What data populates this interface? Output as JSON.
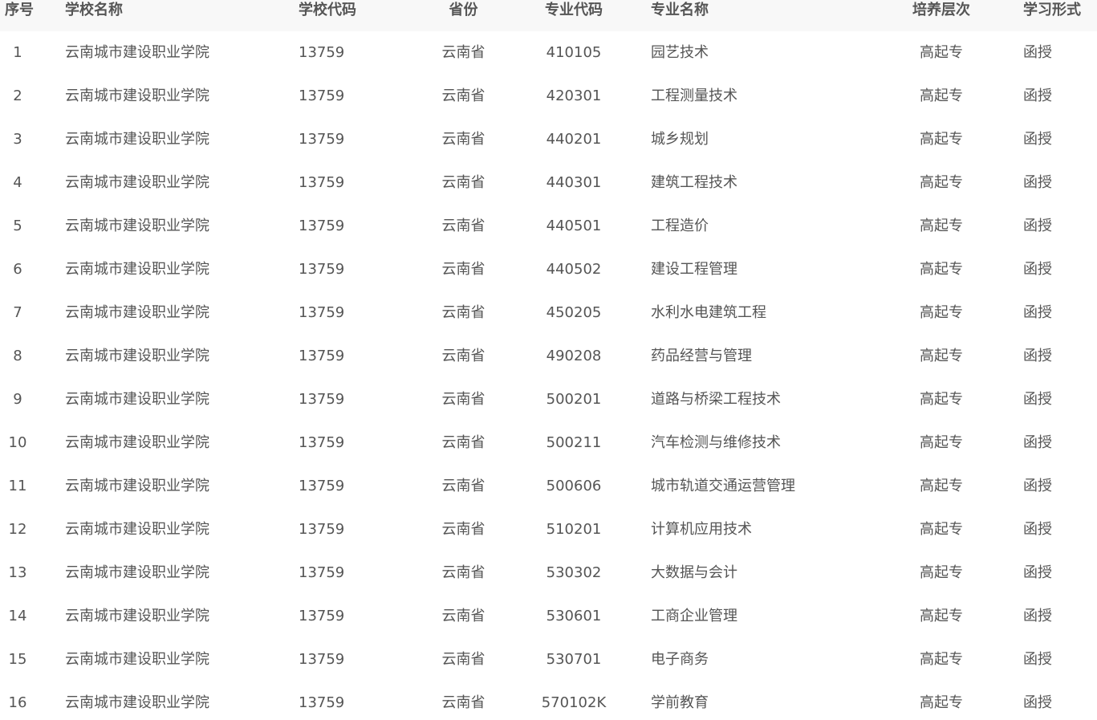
{
  "table": {
    "headers": [
      "序号",
      "学校名称",
      "学校代码",
      "省份",
      "专业代码",
      "专业名称",
      "培养层次",
      "学习形式"
    ],
    "rows": [
      [
        "1",
        "云南城市建设职业学院",
        "13759",
        "云南省",
        "410105",
        "园艺技术",
        "高起专",
        "函授"
      ],
      [
        "2",
        "云南城市建设职业学院",
        "13759",
        "云南省",
        "420301",
        "工程测量技术",
        "高起专",
        "函授"
      ],
      [
        "3",
        "云南城市建设职业学院",
        "13759",
        "云南省",
        "440201",
        "城乡规划",
        "高起专",
        "函授"
      ],
      [
        "4",
        "云南城市建设职业学院",
        "13759",
        "云南省",
        "440301",
        "建筑工程技术",
        "高起专",
        "函授"
      ],
      [
        "5",
        "云南城市建设职业学院",
        "13759",
        "云南省",
        "440501",
        "工程造价",
        "高起专",
        "函授"
      ],
      [
        "6",
        "云南城市建设职业学院",
        "13759",
        "云南省",
        "440502",
        "建设工程管理",
        "高起专",
        "函授"
      ],
      [
        "7",
        "云南城市建设职业学院",
        "13759",
        "云南省",
        "450205",
        "水利水电建筑工程",
        "高起专",
        "函授"
      ],
      [
        "8",
        "云南城市建设职业学院",
        "13759",
        "云南省",
        "490208",
        "药品经营与管理",
        "高起专",
        "函授"
      ],
      [
        "9",
        "云南城市建设职业学院",
        "13759",
        "云南省",
        "500201",
        "道路与桥梁工程技术",
        "高起专",
        "函授"
      ],
      [
        "10",
        "云南城市建设职业学院",
        "13759",
        "云南省",
        "500211",
        "汽车检测与维修技术",
        "高起专",
        "函授"
      ],
      [
        "11",
        "云南城市建设职业学院",
        "13759",
        "云南省",
        "500606",
        "城市轨道交通运营管理",
        "高起专",
        "函授"
      ],
      [
        "12",
        "云南城市建设职业学院",
        "13759",
        "云南省",
        "510201",
        "计算机应用技术",
        "高起专",
        "函授"
      ],
      [
        "13",
        "云南城市建设职业学院",
        "13759",
        "云南省",
        "530302",
        "大数据与会计",
        "高起专",
        "函授"
      ],
      [
        "14",
        "云南城市建设职业学院",
        "13759",
        "云南省",
        "530601",
        "工商企业管理",
        "高起专",
        "函授"
      ],
      [
        "15",
        "云南城市建设职业学院",
        "13759",
        "云南省",
        "530701",
        "电子商务",
        "高起专",
        "函授"
      ],
      [
        "16",
        "云南城市建设职业学院",
        "13759",
        "云南省",
        "570102K",
        "学前教育",
        "高起专",
        "函授"
      ]
    ]
  }
}
